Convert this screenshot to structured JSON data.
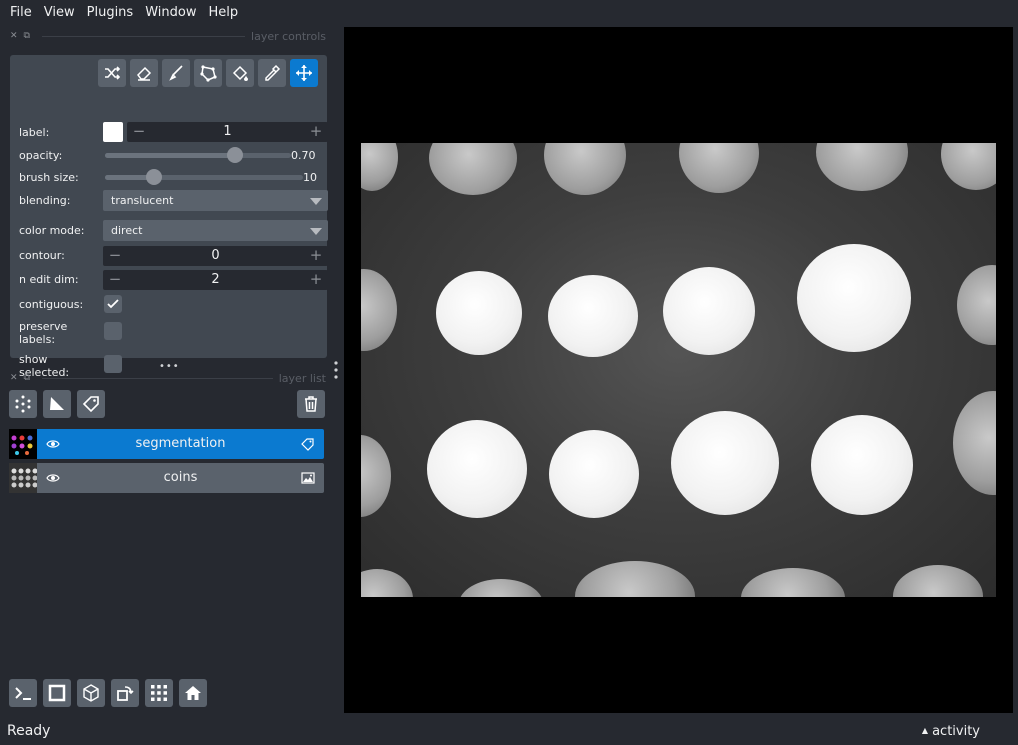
{
  "menu": [
    "File",
    "View",
    "Plugins",
    "Window",
    "Help"
  ],
  "layer_controls": {
    "title": "layer controls",
    "label": {
      "label": "label:",
      "value": "1"
    },
    "opacity": {
      "label": "opacity:",
      "value": "0.70",
      "fraction": 0.7
    },
    "brush_size": {
      "label": "brush size:",
      "value": "10"
    },
    "blending": {
      "label": "blending:",
      "value": "translucent"
    },
    "color_mode": {
      "label": "color mode:",
      "value": "direct"
    },
    "contour": {
      "label": "contour:",
      "value": "0"
    },
    "n_edit_dim": {
      "label": "n edit dim:",
      "value": "2"
    },
    "contiguous": {
      "label": "contiguous:",
      "checked": true
    },
    "preserve_labels": {
      "label_1": "preserve",
      "label_2": "labels:",
      "checked": false
    },
    "show_selected": {
      "label_1": "show",
      "label_2": "selected:",
      "checked": false
    },
    "tools": [
      "shuffle-icon",
      "eraser-icon",
      "paint-brush-icon",
      "polygon-icon",
      "fill-bucket-icon",
      "color-picker-icon",
      "move-icon"
    ],
    "active_tool": "move-icon"
  },
  "layer_list": {
    "title": "layer list",
    "layers": [
      {
        "name": "segmentation",
        "type": "labels",
        "selected": true
      },
      {
        "name": "coins",
        "type": "image",
        "selected": false
      }
    ]
  },
  "status": {
    "text": "Ready",
    "activity": "activity"
  },
  "colors": {
    "accent": "#0b7ad0",
    "panel": "#414851",
    "background": "#262930"
  }
}
